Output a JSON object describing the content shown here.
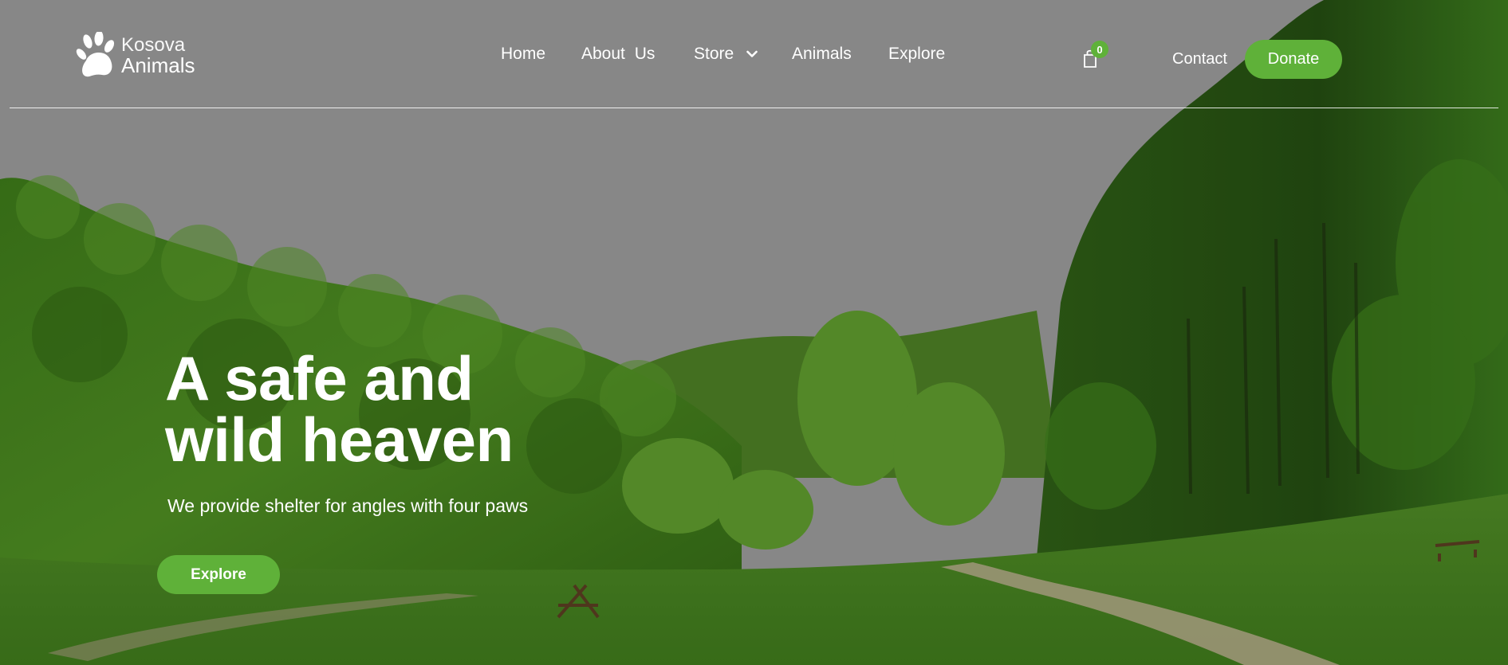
{
  "brand": {
    "line1": "Kosova",
    "line2": "Animals",
    "icon": "paw-icon"
  },
  "nav": {
    "items": [
      {
        "label": "Home"
      },
      {
        "label": "About  Us"
      },
      {
        "label": "Store",
        "has_dropdown": true
      },
      {
        "label": "Animals"
      },
      {
        "label": "Explore"
      }
    ]
  },
  "cart": {
    "icon": "shopping-bag-icon",
    "count": "0"
  },
  "header_actions": {
    "contact_label": "Contact",
    "donate_label": "Donate"
  },
  "hero": {
    "title_line1": "A safe and",
    "title_line2": "wild heaven",
    "subtitle": "We provide shelter for angles with four paws",
    "button_label": "Explore"
  },
  "colors": {
    "accent": "#5fb139",
    "sky": "#9a9a9a",
    "text": "#ffffff"
  }
}
